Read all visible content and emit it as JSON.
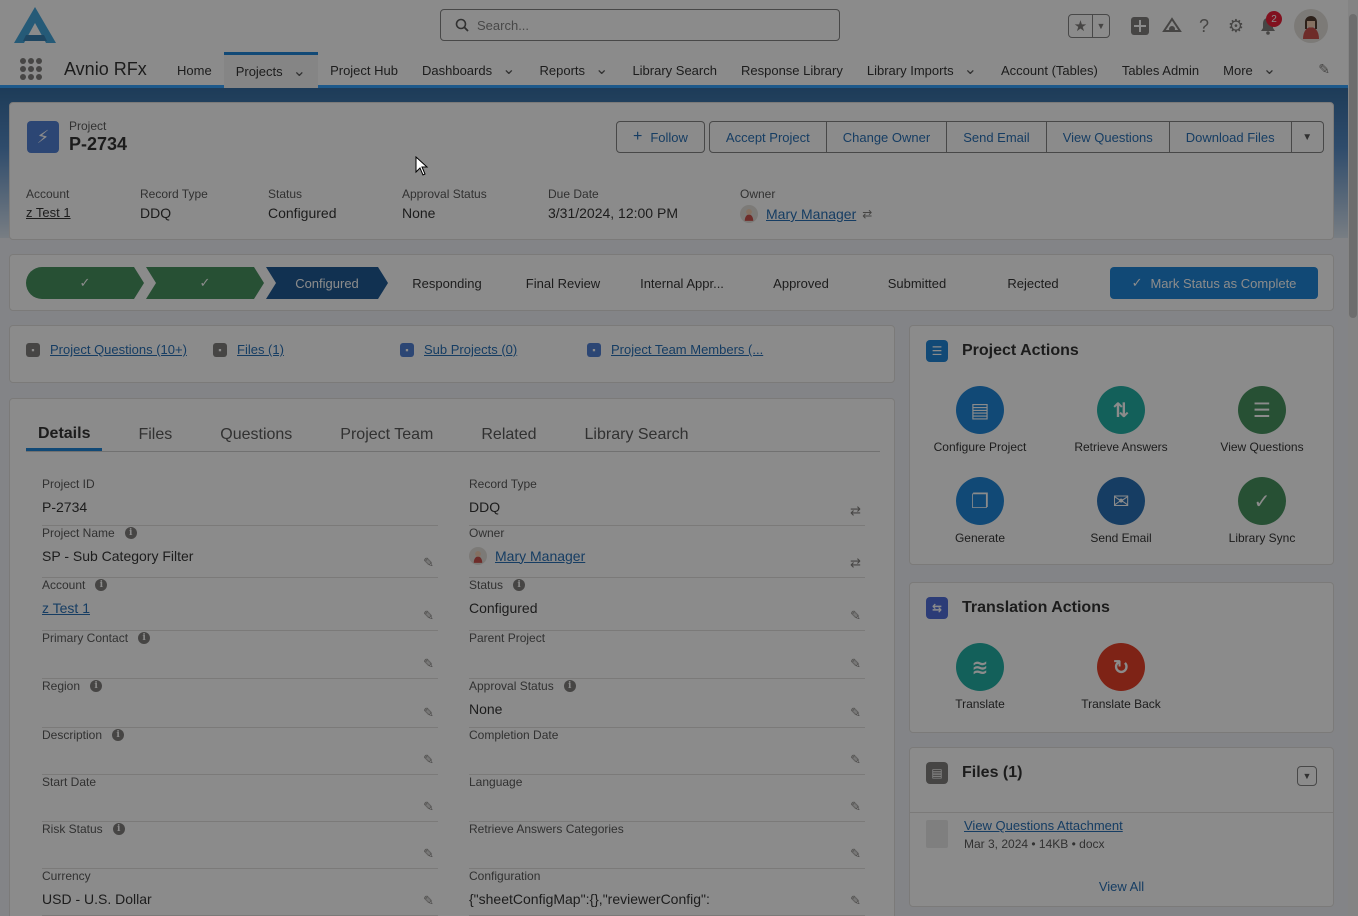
{
  "header": {
    "search_placeholder": "Search...",
    "notification_count": "2"
  },
  "nav": {
    "app_name": "Avnio RFx",
    "items": [
      {
        "label": "Home",
        "dropdown": false,
        "active": false
      },
      {
        "label": "Projects",
        "dropdown": true,
        "active": true
      },
      {
        "label": "Project Hub",
        "dropdown": false,
        "active": false
      },
      {
        "label": "Dashboards",
        "dropdown": true,
        "active": false
      },
      {
        "label": "Reports",
        "dropdown": true,
        "active": false
      },
      {
        "label": "Library Search",
        "dropdown": false,
        "active": false
      },
      {
        "label": "Response Library",
        "dropdown": false,
        "active": false
      },
      {
        "label": "Library Imports",
        "dropdown": true,
        "active": false
      },
      {
        "label": "Account (Tables)",
        "dropdown": false,
        "active": false
      },
      {
        "label": "Tables Admin",
        "dropdown": false,
        "active": false
      },
      {
        "label": "More",
        "dropdown": true,
        "active": false
      }
    ]
  },
  "record": {
    "object_label": "Project",
    "name": "P-2734",
    "follow_label": "Follow",
    "actions": [
      "Accept Project",
      "Change Owner",
      "Send Email",
      "View Questions",
      "Download Files"
    ],
    "highlights": {
      "account_label": "Account",
      "account_value": "z Test 1",
      "record_type_label": "Record Type",
      "record_type_value": "DDQ",
      "status_label": "Status",
      "status_value": "Configured",
      "approval_label": "Approval Status",
      "approval_value": "None",
      "due_label": "Due Date",
      "due_value": "3/31/2024, 12:00 PM",
      "owner_label": "Owner",
      "owner_value": "Mary Manager"
    }
  },
  "path": {
    "steps": [
      {
        "label": "✓",
        "state": "done"
      },
      {
        "label": "✓",
        "state": "done"
      },
      {
        "label": "Configured",
        "state": "current"
      },
      {
        "label": "Responding",
        "state": "todo"
      },
      {
        "label": "Final Review",
        "state": "todo"
      },
      {
        "label": "Internal Appr...",
        "state": "todo"
      },
      {
        "label": "Approved",
        "state": "todo"
      },
      {
        "label": "Submitted",
        "state": "todo"
      },
      {
        "label": "Rejected",
        "state": "todo"
      }
    ],
    "complete_label": "Mark Status as Complete"
  },
  "related_links": {
    "questions": "Project Questions (10+)",
    "files": "Files (1)",
    "sub_projects": "Sub Projects (0)",
    "team": "Project Team Members (..."
  },
  "tabs": [
    "Details",
    "Files",
    "Questions",
    "Project Team",
    "Related",
    "Library Search"
  ],
  "details": {
    "left": [
      {
        "label": "Project ID",
        "value": "P-2734",
        "info": false,
        "edit": false,
        "link": false
      },
      {
        "label": "Project Name",
        "value": "SP - Sub Category Filter",
        "info": true,
        "edit": true,
        "link": false
      },
      {
        "label": "Account",
        "value": "z Test 1",
        "info": true,
        "edit": true,
        "link": true
      },
      {
        "label": "Primary Contact",
        "value": "",
        "info": true,
        "edit": true,
        "link": false
      },
      {
        "label": "Region",
        "value": "",
        "info": true,
        "edit": true,
        "link": false
      },
      {
        "label": "Description",
        "value": "",
        "info": true,
        "edit": true,
        "link": false
      },
      {
        "label": "Start Date",
        "value": "",
        "info": false,
        "edit": true,
        "link": false
      },
      {
        "label": "Risk Status",
        "value": "",
        "info": true,
        "edit": true,
        "link": false
      },
      {
        "label": "Currency",
        "value": "USD - U.S. Dollar",
        "info": false,
        "edit": true,
        "link": false
      }
    ],
    "right": [
      {
        "label": "Record Type",
        "value": "DDQ",
        "info": false,
        "edit": false,
        "link": false
      },
      {
        "label": "Owner",
        "value": "Mary Manager",
        "info": false,
        "edit": false,
        "link": true
      },
      {
        "label": "Status",
        "value": "Configured",
        "info": true,
        "edit": true,
        "link": false
      },
      {
        "label": "Parent Project",
        "value": "",
        "info": false,
        "edit": true,
        "link": false
      },
      {
        "label": "Approval Status",
        "value": "None",
        "info": true,
        "edit": true,
        "link": false
      },
      {
        "label": "Completion Date",
        "value": "",
        "info": false,
        "edit": true,
        "link": false
      },
      {
        "label": "Language",
        "value": "",
        "info": false,
        "edit": true,
        "link": false
      },
      {
        "label": "Retrieve Answers Categories",
        "value": "",
        "info": false,
        "edit": true,
        "link": false
      },
      {
        "label": "Configuration",
        "value": "{\"sheetConfigMap\":{},\"reviewerConfig\":",
        "info": false,
        "edit": true,
        "link": false
      }
    ]
  },
  "project_actions": {
    "title": "Project Actions",
    "items": [
      {
        "label": "Configure Project",
        "color": "#0176d3",
        "icon": "configure-icon"
      },
      {
        "label": "Retrieve Answers",
        "color": "#06a59a",
        "icon": "retrieve-icon"
      },
      {
        "label": "View Questions",
        "color": "#2e844a",
        "icon": "list-icon"
      },
      {
        "label": "Generate",
        "color": "#0176d3",
        "icon": "generate-icon"
      },
      {
        "label": "Send Email",
        "color": "#0b5cab",
        "icon": "email-icon"
      },
      {
        "label": "Library Sync",
        "color": "#2e844a",
        "icon": "sync-icon"
      }
    ]
  },
  "translation_actions": {
    "title": "Translation Actions",
    "items": [
      {
        "label": "Translate",
        "color": "#06a59a",
        "icon": "translate-icon"
      },
      {
        "label": "Translate Back",
        "color": "#e3260b",
        "icon": "translate-back-icon"
      }
    ]
  },
  "files_card": {
    "title": "Files (1)",
    "file_name": "View Questions Attachment",
    "file_date": "Mar 3, 2024",
    "file_size": "14KB",
    "file_ext": "docx",
    "view_all": "View All"
  },
  "colors": {
    "brand": "#0176d3",
    "path_done": "#2e844a",
    "path_current": "#014486"
  }
}
